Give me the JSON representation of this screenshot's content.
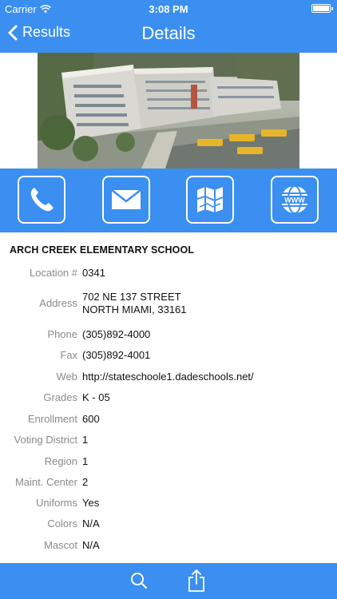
{
  "status_bar": {
    "carrier": "Carrier",
    "time": "3:08 PM"
  },
  "nav": {
    "back_label": "Results",
    "title": "Details"
  },
  "actions": [
    {
      "icon": "phone-icon"
    },
    {
      "icon": "mail-icon"
    },
    {
      "icon": "map-icon"
    },
    {
      "icon": "www-globe-icon"
    }
  ],
  "school": {
    "name": "ARCH CREEK ELEMENTARY SCHOOL",
    "fields": [
      {
        "label": "Location #",
        "value": "0341"
      },
      {
        "label": "Address",
        "value": "702 NE 137 STREET",
        "value2": "NORTH MIAMI, 33161"
      },
      {
        "label": "Phone",
        "value": "(305)892-4000"
      },
      {
        "label": "Fax",
        "value": "(305)892-4001"
      },
      {
        "label": "Web",
        "value": "http://stateschoole1.dadeschools.net/"
      },
      {
        "label": "Grades",
        "value": "K - 05"
      },
      {
        "label": "Enrollment",
        "value": "600"
      },
      {
        "label": "Voting District",
        "value": "1"
      },
      {
        "label": "Region",
        "value": "1"
      },
      {
        "label": "Maint. Center",
        "value": "2"
      },
      {
        "label": "Uniforms",
        "value": "Yes"
      },
      {
        "label": "Colors",
        "value": "N/A"
      },
      {
        "label": "Mascot",
        "value": "N/A"
      }
    ]
  },
  "bottom_bar": {
    "icons": [
      "search-icon",
      "share-icon"
    ]
  },
  "colors": {
    "accent": "#3a8ff0",
    "label_gray": "#8a8a8a"
  }
}
